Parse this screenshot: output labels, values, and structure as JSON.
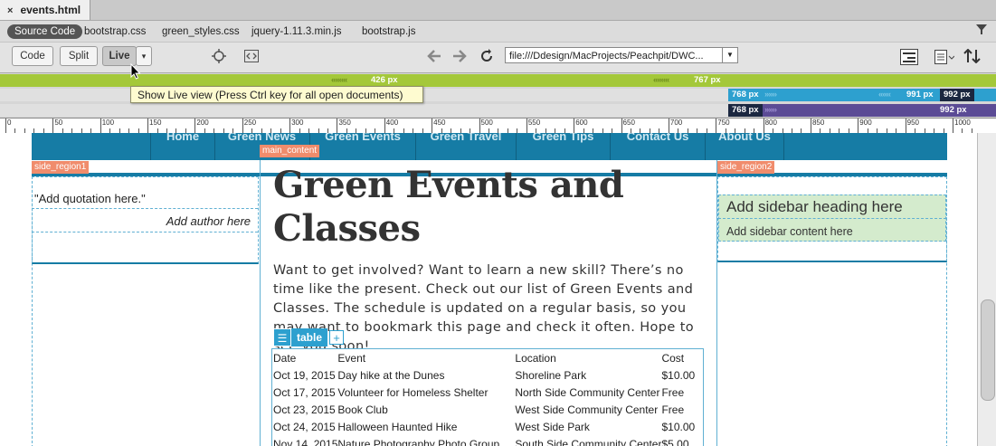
{
  "document_tab": {
    "close": "×",
    "title": "events.html"
  },
  "related_files": [
    "Source Code",
    "bootstrap.css",
    "green_styles.css",
    "jquery-1.11.3.min.js",
    "bootstrap.js"
  ],
  "toolbar": {
    "code_label": "Code",
    "split_label": "Split",
    "live_label": "Live",
    "live_dropdown": "▾",
    "back_icon": "arrow-left-icon",
    "forward_icon": "arrow-right-icon",
    "refresh_icon": "refresh-icon",
    "url": "file:///Ddesign/MacProjects/Peachpit/DWC..."
  },
  "tooltip": "Show Live view (Press Ctrl key for all open documents)",
  "media_queries": {
    "green_min": "426  px",
    "green_max": "767  px",
    "blue_min": "768  px",
    "blue_max": "991  px",
    "blue_cap": "992  px",
    "purple_min": "768  px",
    "purple_max": "992  px"
  },
  "ruler_labels": [
    "0",
    "50",
    "100",
    "150",
    "200",
    "250",
    "300",
    "350",
    "400",
    "450",
    "500",
    "550",
    "600",
    "650",
    "700",
    "750",
    "800",
    "850",
    "900",
    "950",
    "1000"
  ],
  "page": {
    "nav": [
      "Home",
      "Green News",
      "Green Events",
      "Green Travel",
      "Green Tips",
      "Contact Us",
      "About Us"
    ],
    "tags": {
      "main": "main_content",
      "side1": "side_region1",
      "side2": "side_region2"
    },
    "quote": "\"Add quotation here.\"",
    "author": "Add author here",
    "sidebar_heading": "Add sidebar heading here",
    "sidebar_content": "Add sidebar content here",
    "title": "Green Events and Classes",
    "intro": "Want to get involved? Want to learn a new skill? There’s no time like the present. Check out our list of Green Events and Classes. The schedule is updated on a regular basis, so you may want to bookmark this page and check it often. Hope to see you soon!",
    "table_tag": {
      "menu": "☰",
      "label": "table",
      "add": "+"
    },
    "table": {
      "headers": [
        "Date",
        "Event",
        "Location",
        "Cost"
      ],
      "rows": [
        [
          "Oct 19, 2015",
          "Day hike at the Dunes",
          "Shoreline Park",
          "$10.00"
        ],
        [
          "Oct 17, 2015",
          "Volunteer for Homeless Shelter",
          "North Side Community Center",
          "Free"
        ],
        [
          "Oct 23, 2015",
          "Book Club",
          "West Side Community Center",
          "Free"
        ],
        [
          "Oct 24, 2015",
          "Halloween Haunted Hike",
          "West Side Park",
          "$10.00"
        ],
        [
          "Nov 14, 2015",
          "Nature Photography Photo Group",
          "South Side Community Center",
          "$5.00"
        ]
      ]
    }
  },
  "colors": {
    "nav": "#167ca5",
    "green_bar": "#a4c83a",
    "blue_bar": "#2da0cf",
    "purple_bar": "#5b4b95",
    "tag": "#f08c6c",
    "sidebar_bg": "#d4ebcd"
  }
}
